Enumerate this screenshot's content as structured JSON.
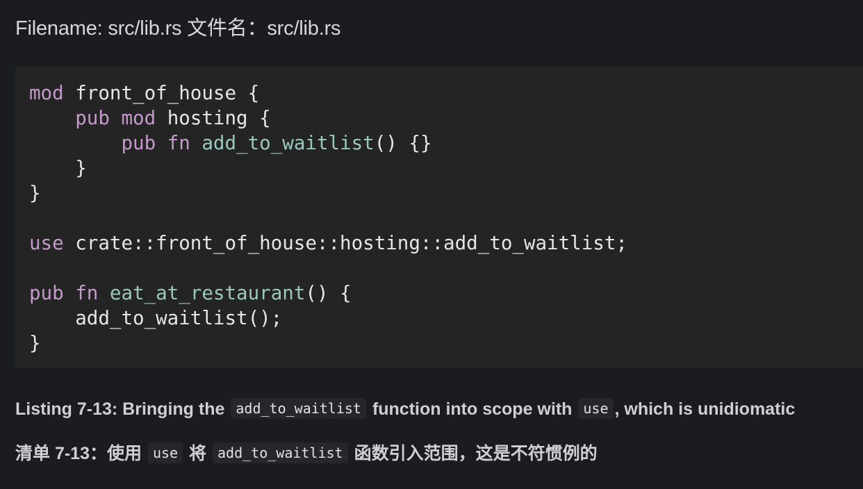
{
  "filename": "Filename: src/lib.rs 文件名：src/lib.rs",
  "code": {
    "kw_mod": "mod",
    "kw_pub": "pub",
    "kw_fn": "fn",
    "kw_use": "use",
    "l1_name": " front_of_house {",
    "l2_name": " hosting {",
    "l3_fn": "add_to_waitlist",
    "l3_rest": "() {}",
    "l4": "    }",
    "l5": "}",
    "l7_rest": " crate::front_of_house::hosting::add_to_waitlist;",
    "l9_fn": "eat_at_restaurant",
    "l9_rest": "() {",
    "l10": "    add_to_waitlist();",
    "l11": "}"
  },
  "caption_en": {
    "part1": "Listing 7-13: Bringing the",
    "code1": "add_to_waitlist",
    "part2": "function into scope with",
    "code2": "use",
    "part3": ", which is unidiomatic"
  },
  "caption_zh": {
    "part1": "清单 7-13：使用",
    "code1": "use",
    "part2": "将",
    "code2": "add_to_waitlist",
    "part3": "函数引入范围，这是不符惯例的"
  }
}
